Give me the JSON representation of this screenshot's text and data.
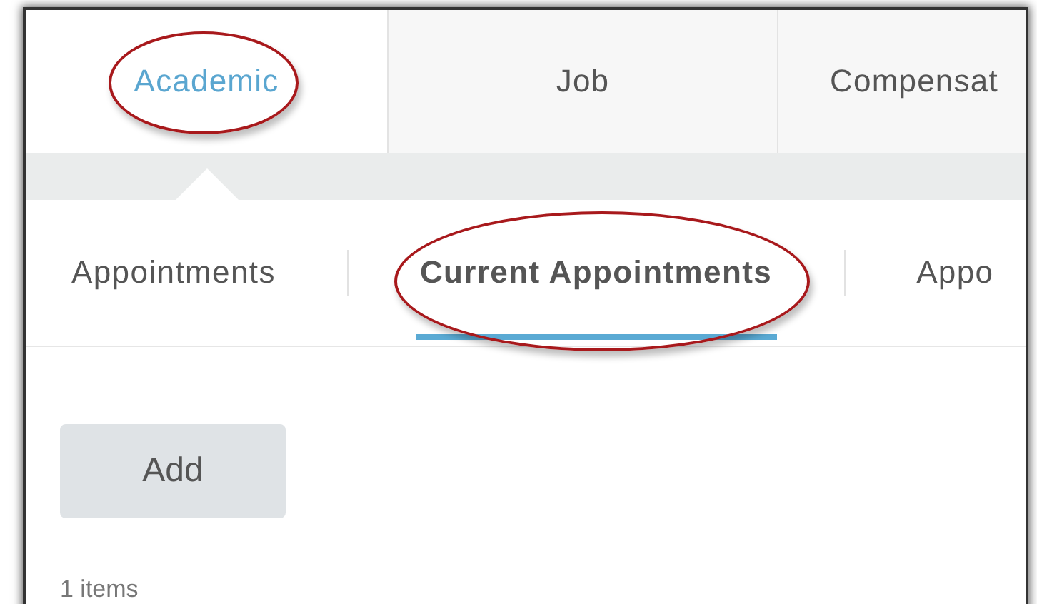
{
  "tabs": [
    {
      "label": "Academic",
      "selected": true,
      "circled": true
    },
    {
      "label": "Job",
      "selected": false,
      "circled": false
    },
    {
      "label": "Compensat",
      "selected": false,
      "circled": false
    }
  ],
  "subtabs": [
    {
      "label": "Appointments",
      "selected": false,
      "circled": false
    },
    {
      "label": "Current Appointments",
      "selected": true,
      "circled": true
    },
    {
      "label": "Appo",
      "selected": false,
      "circled": false
    }
  ],
  "add_button": "Add",
  "item_count": "1 items"
}
